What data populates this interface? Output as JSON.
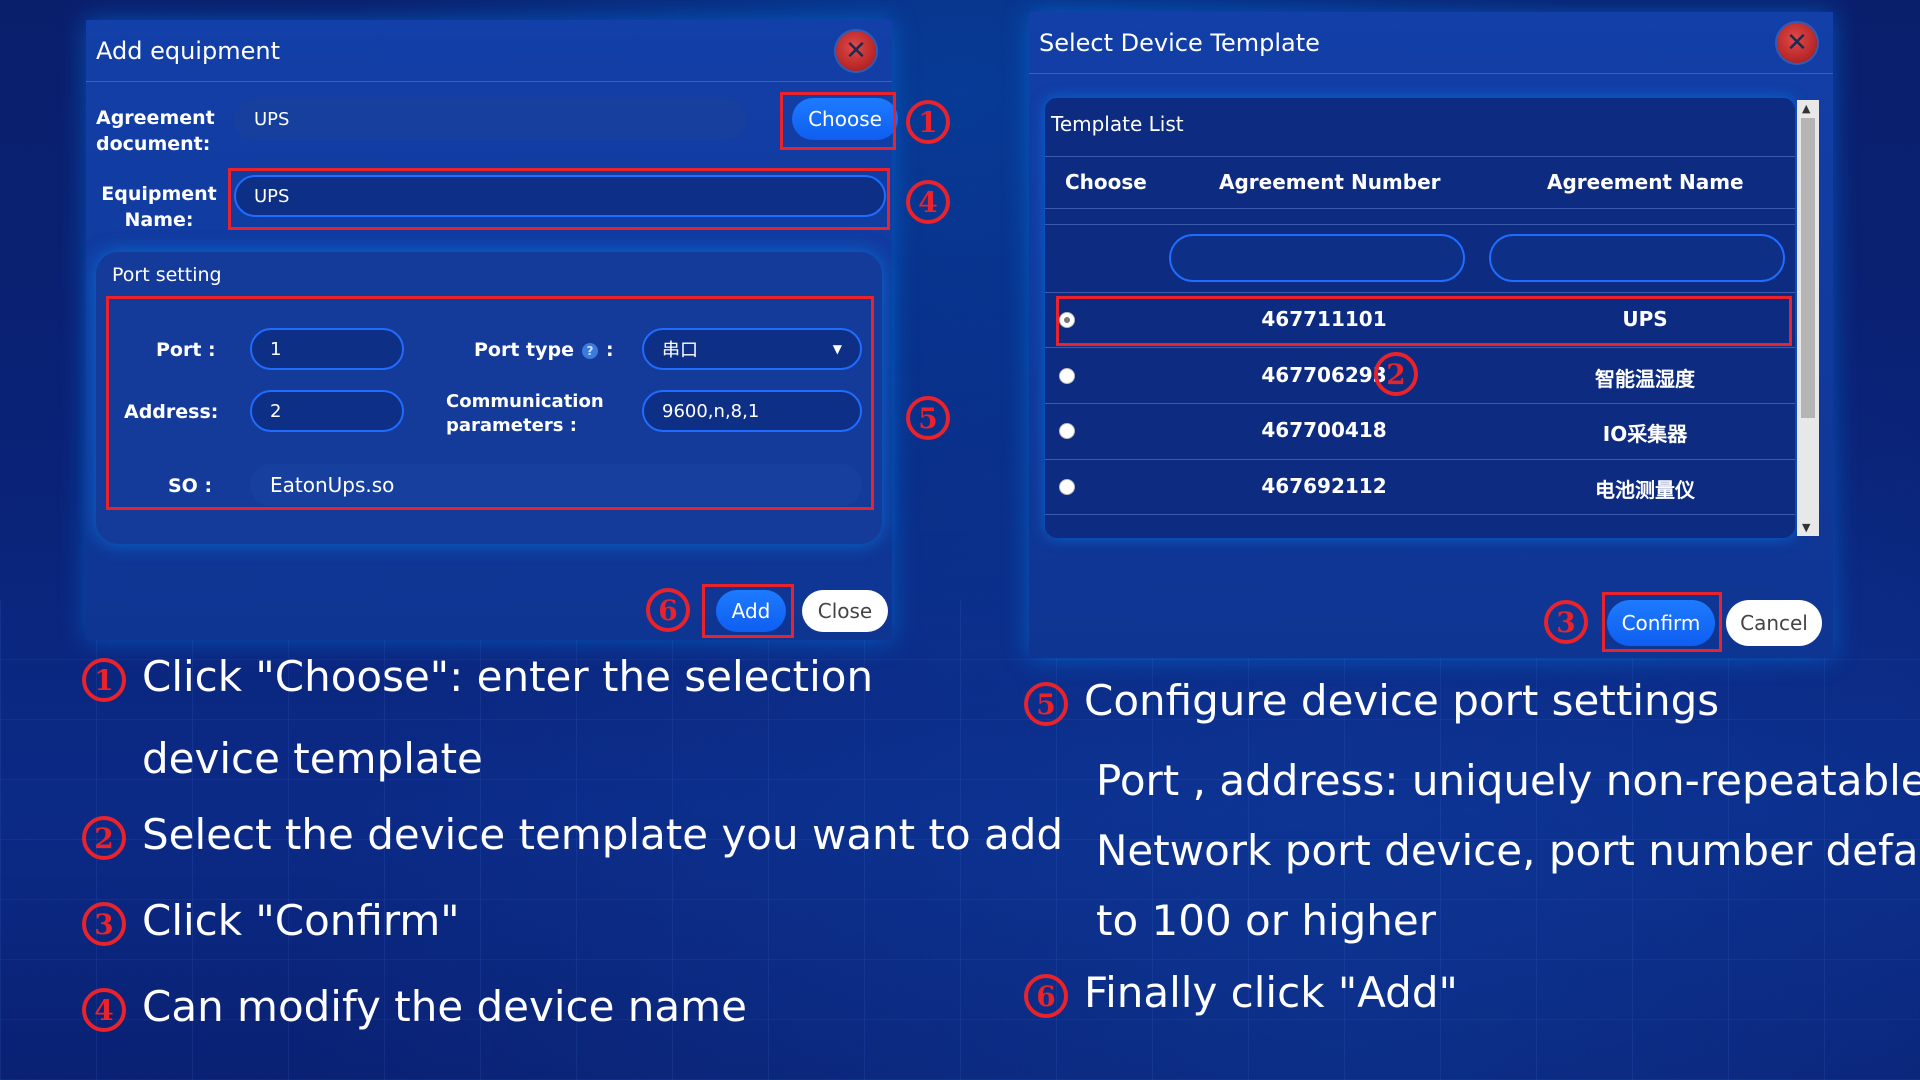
{
  "add_dialog": {
    "title": "Add equipment",
    "agreement_label_1": "Agreement",
    "agreement_label_2": "document:",
    "agreement_value": "UPS",
    "choose_button": "Choose",
    "equipment_label_1": "Equipment",
    "equipment_label_2": "Name:",
    "equipment_value": "UPS",
    "port_setting_title": "Port setting",
    "port_label": "Port :",
    "port_value": "1",
    "port_type_label": "Port type",
    "port_type_colon": ":",
    "port_type_value": "串口",
    "address_label": "Address:",
    "address_value": "2",
    "comm_label_1": "Communication",
    "comm_label_2": "parameters :",
    "comm_value": "9600,n,8,1",
    "so_label": "SO :",
    "so_value": "EatonUps.so",
    "add_button": "Add",
    "close_button": "Close"
  },
  "template_dialog": {
    "title": "Select Device Template",
    "list_title": "Template List",
    "columns": [
      "Choose",
      "Agreement Number",
      "Agreement Name"
    ],
    "rows": [
      {
        "number": "467711101",
        "name": "UPS",
        "selected": true
      },
      {
        "number": "467706293",
        "name": "智能温湿度",
        "selected": false
      },
      {
        "number": "467700418",
        "name": "IO采集器",
        "selected": false
      },
      {
        "number": "467692112",
        "name": "电池测量仪",
        "selected": false
      }
    ],
    "confirm_button": "Confirm",
    "cancel_button": "Cancel"
  },
  "markers": {
    "m1": "1",
    "m2": "2",
    "m3": "3",
    "m4": "4",
    "m5": "5",
    "m6": "6"
  },
  "instructions": {
    "step1_line1": "Click \"Choose\": enter the selection",
    "step1_line2": "device template",
    "step2": "Select the device template you want to add",
    "step3": "Click \"Confirm\"",
    "step4": "Can modify the device name",
    "step5_title": "Configure device port settings",
    "step5_line1": "Port  , address: uniquely non-repeatable",
    "step5_line2": "Network port device, port number defaults",
    "step5_line3": "to 100 or higher",
    "step6": "Finally click \"Add\""
  },
  "colors": {
    "highlight": "#e8232c",
    "primary_button": "#1d7bff",
    "dialog_bg": "#123fa8"
  },
  "icons": [
    "close-icon",
    "help-icon",
    "dropdown-arrow-icon",
    "radio-icon",
    "scroll-up-icon",
    "scroll-down-icon"
  ]
}
